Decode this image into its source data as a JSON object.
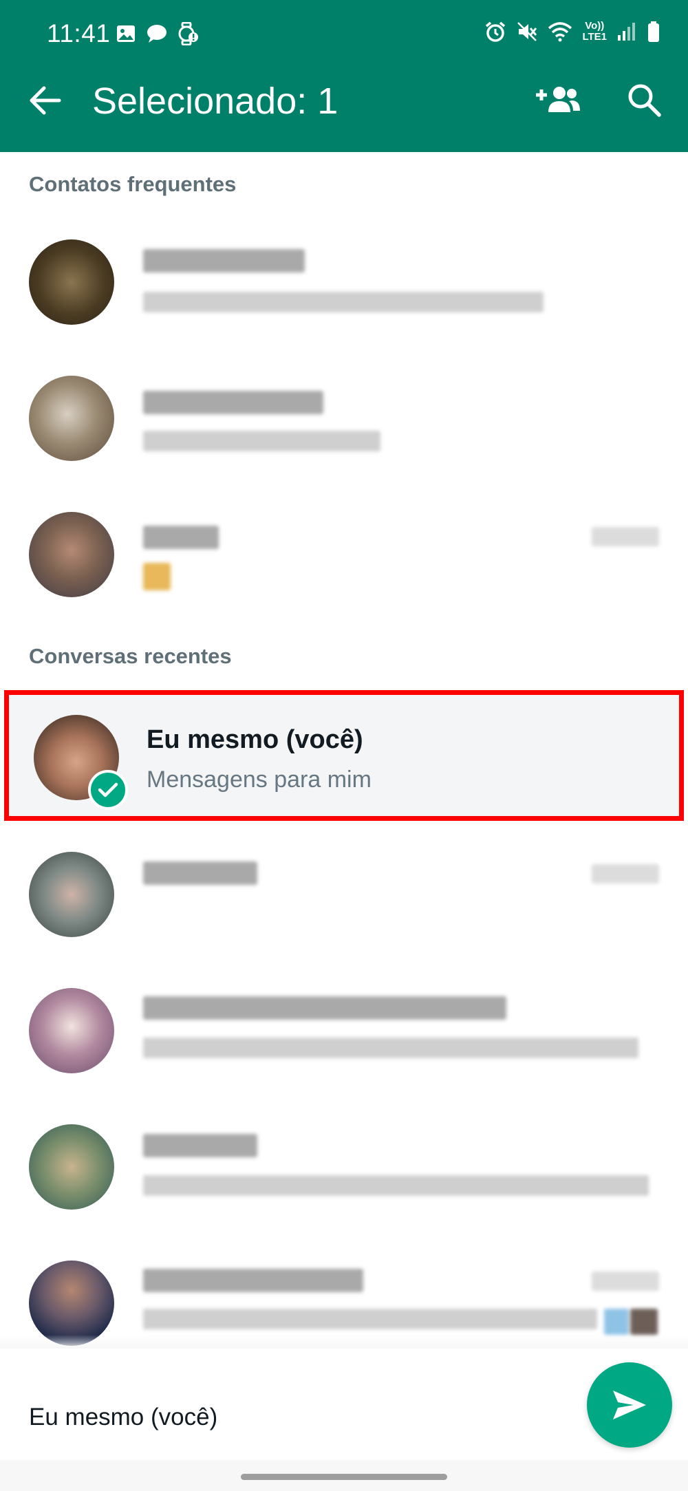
{
  "status_bar": {
    "time": "11:41",
    "network": {
      "top": "Vo))",
      "bottom": "LTE1"
    }
  },
  "app_bar": {
    "title": "Selecionado: 1"
  },
  "sections": {
    "frequent_contacts": "Contatos frequentes",
    "recent_chats": "Conversas recentes"
  },
  "selected_contact": {
    "name": "Eu mesmo (você)",
    "subtitle": "Mensagens para mim"
  },
  "bottom_bar": {
    "selected_names": "Eu mesmo (você)"
  },
  "colors": {
    "header": "#008069",
    "accent": "#00a884",
    "highlight_border": "#ff0000"
  },
  "icons": {
    "back": "arrow-left-icon",
    "add_contact": "add-contact-icon",
    "search": "search-icon",
    "send": "send-icon",
    "check": "check-icon"
  }
}
